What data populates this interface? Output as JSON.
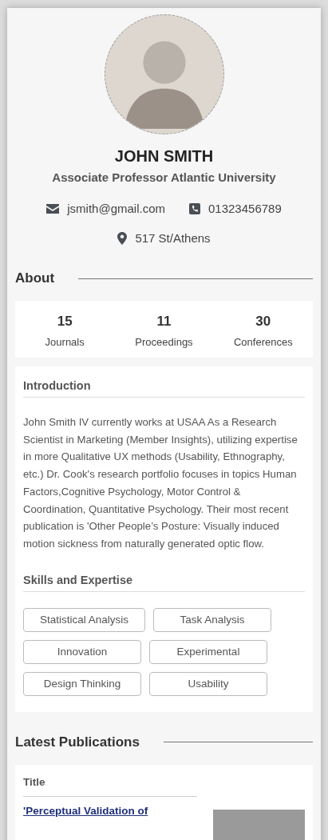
{
  "profile": {
    "name": "JOHN SMITH",
    "title": "Associate Professor Atlantic University",
    "email": "jsmith@gmail.com",
    "phone": "01323456789",
    "location": "517 St/Athens"
  },
  "about": {
    "heading": "About",
    "stats": [
      {
        "value": "15",
        "label": "Journals"
      },
      {
        "value": "11",
        "label": "Proceedings"
      },
      {
        "value": "30",
        "label": "Conferences"
      }
    ]
  },
  "introduction": {
    "heading": "Introduction",
    "text": "John Smith IV currently works at USAA As a Research Scientist in Marketing (Member Insights), utilizing expertise in more Qualitative UX methods (Usability, Ethnography, etc.) Dr. Cook's research portfolio focuses in topics Human Factors,Cognitive Psychology, Motor Control & Coordination, Quantitative Psychology. Their most recent publication is 'Other People’s Posture: Visually induced motion sickness from naturally generated optic flow."
  },
  "skills": {
    "heading": "Skills and Expertise",
    "items": [
      "Statistical Analysis",
      "Task Analysis",
      "Innovation",
      "Experimental",
      "Design Thinking",
      "Usability"
    ]
  },
  "publications": {
    "heading": "Latest Publications",
    "column_title": "Title",
    "rows": [
      {
        "title": "'Perceptual Validation of"
      }
    ]
  }
}
